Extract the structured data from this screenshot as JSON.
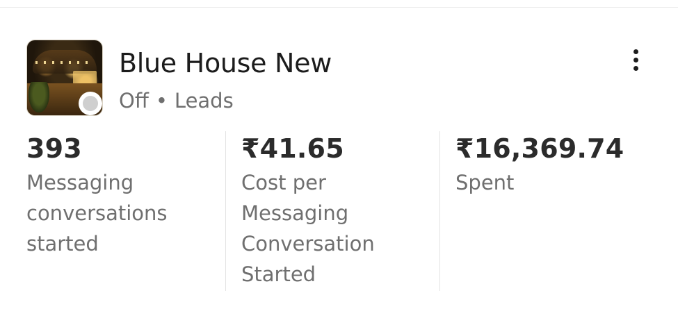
{
  "campaign": {
    "name": "Blue House New",
    "status": "Off",
    "separator": "•",
    "objective": "Leads"
  },
  "metrics": [
    {
      "value": "393",
      "label_lines": [
        "Messaging",
        "conversations",
        "started"
      ]
    },
    {
      "value": "₹41.65",
      "label_lines": [
        "Cost per",
        "Messaging",
        "Conversation",
        "Started"
      ]
    },
    {
      "value": "₹16,369.74",
      "label_lines": [
        "Spent"
      ]
    }
  ],
  "icons": {
    "more": "more-vertical-icon",
    "status": "status-off-dot"
  },
  "colors": {
    "status_dot": "#cfcfcf",
    "title": "#1c1c1c",
    "secondary_text": "#6f6f6f"
  }
}
